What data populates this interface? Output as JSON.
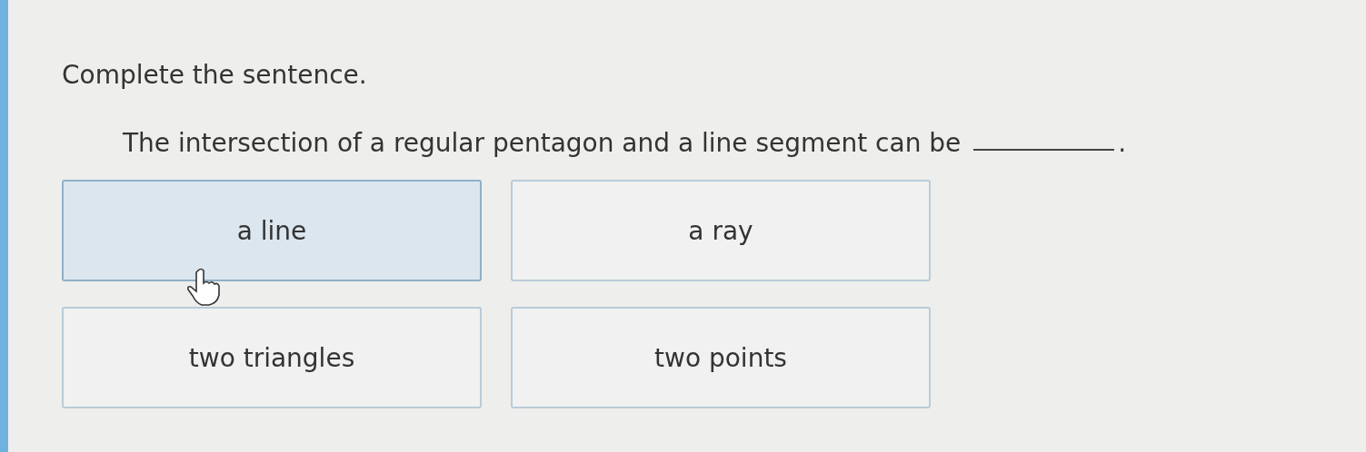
{
  "instruction": "Complete the sentence.",
  "question": {
    "text": "The intersection of a regular pentagon and a line segment can be",
    "end": "."
  },
  "options": [
    {
      "label": "a line",
      "selected": true
    },
    {
      "label": "a ray",
      "selected": false
    },
    {
      "label": "two triangles",
      "selected": false
    },
    {
      "label": "two points",
      "selected": false
    }
  ]
}
